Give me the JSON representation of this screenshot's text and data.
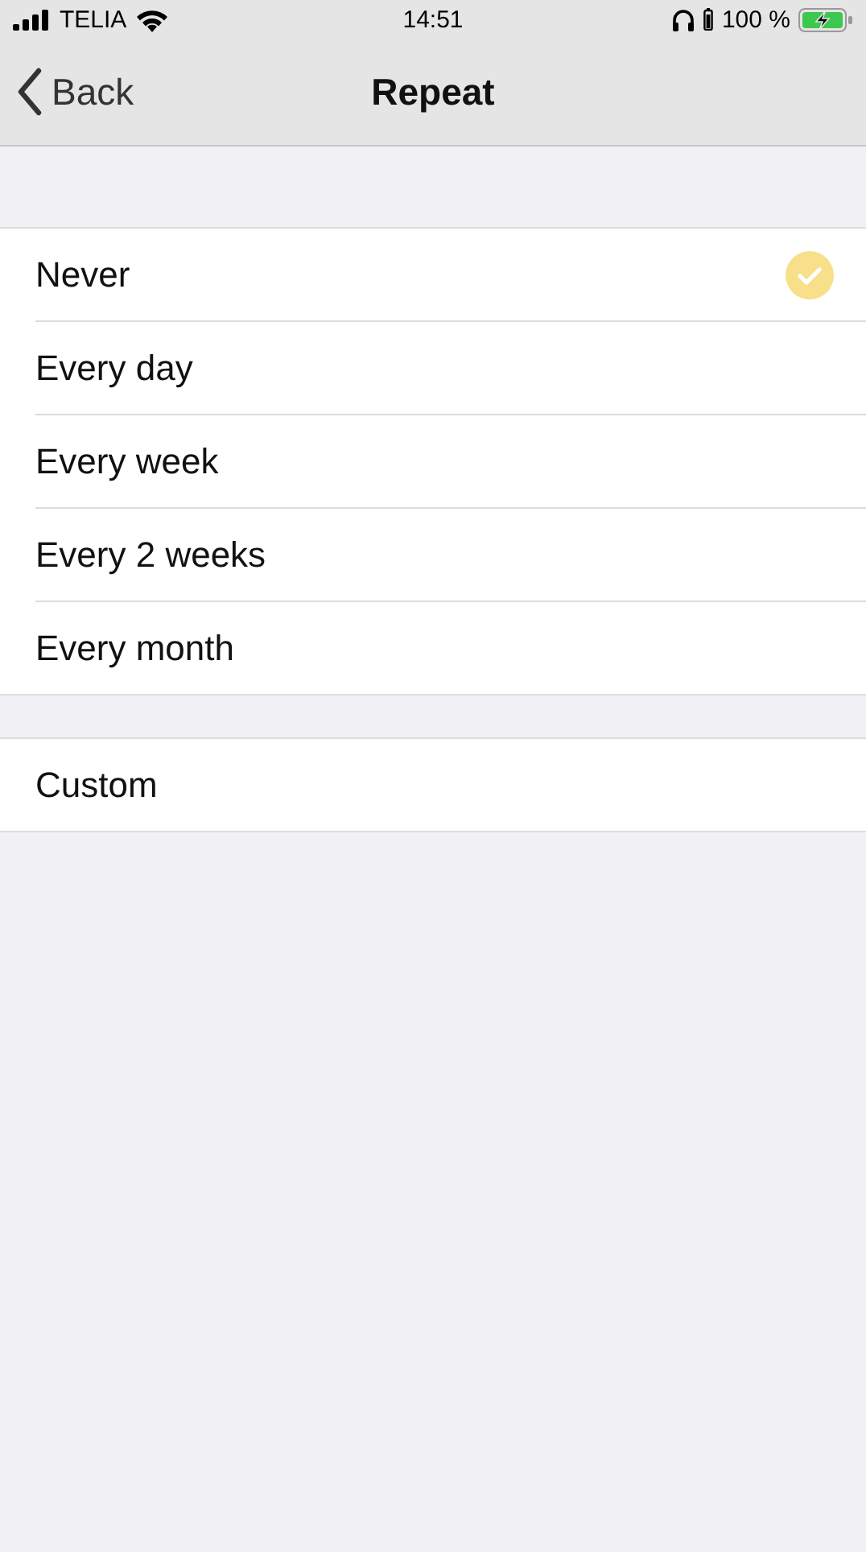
{
  "status_bar": {
    "carrier": "TELIA",
    "time": "14:51",
    "battery": "100 %"
  },
  "nav": {
    "back": "Back",
    "title": "Repeat"
  },
  "sections": [
    {
      "items": [
        {
          "label": "Never",
          "selected": true
        },
        {
          "label": "Every day",
          "selected": false
        },
        {
          "label": "Every week",
          "selected": false
        },
        {
          "label": "Every 2 weeks",
          "selected": false
        },
        {
          "label": "Every month",
          "selected": false
        }
      ]
    },
    {
      "items": [
        {
          "label": "Custom",
          "selected": false
        }
      ]
    }
  ]
}
